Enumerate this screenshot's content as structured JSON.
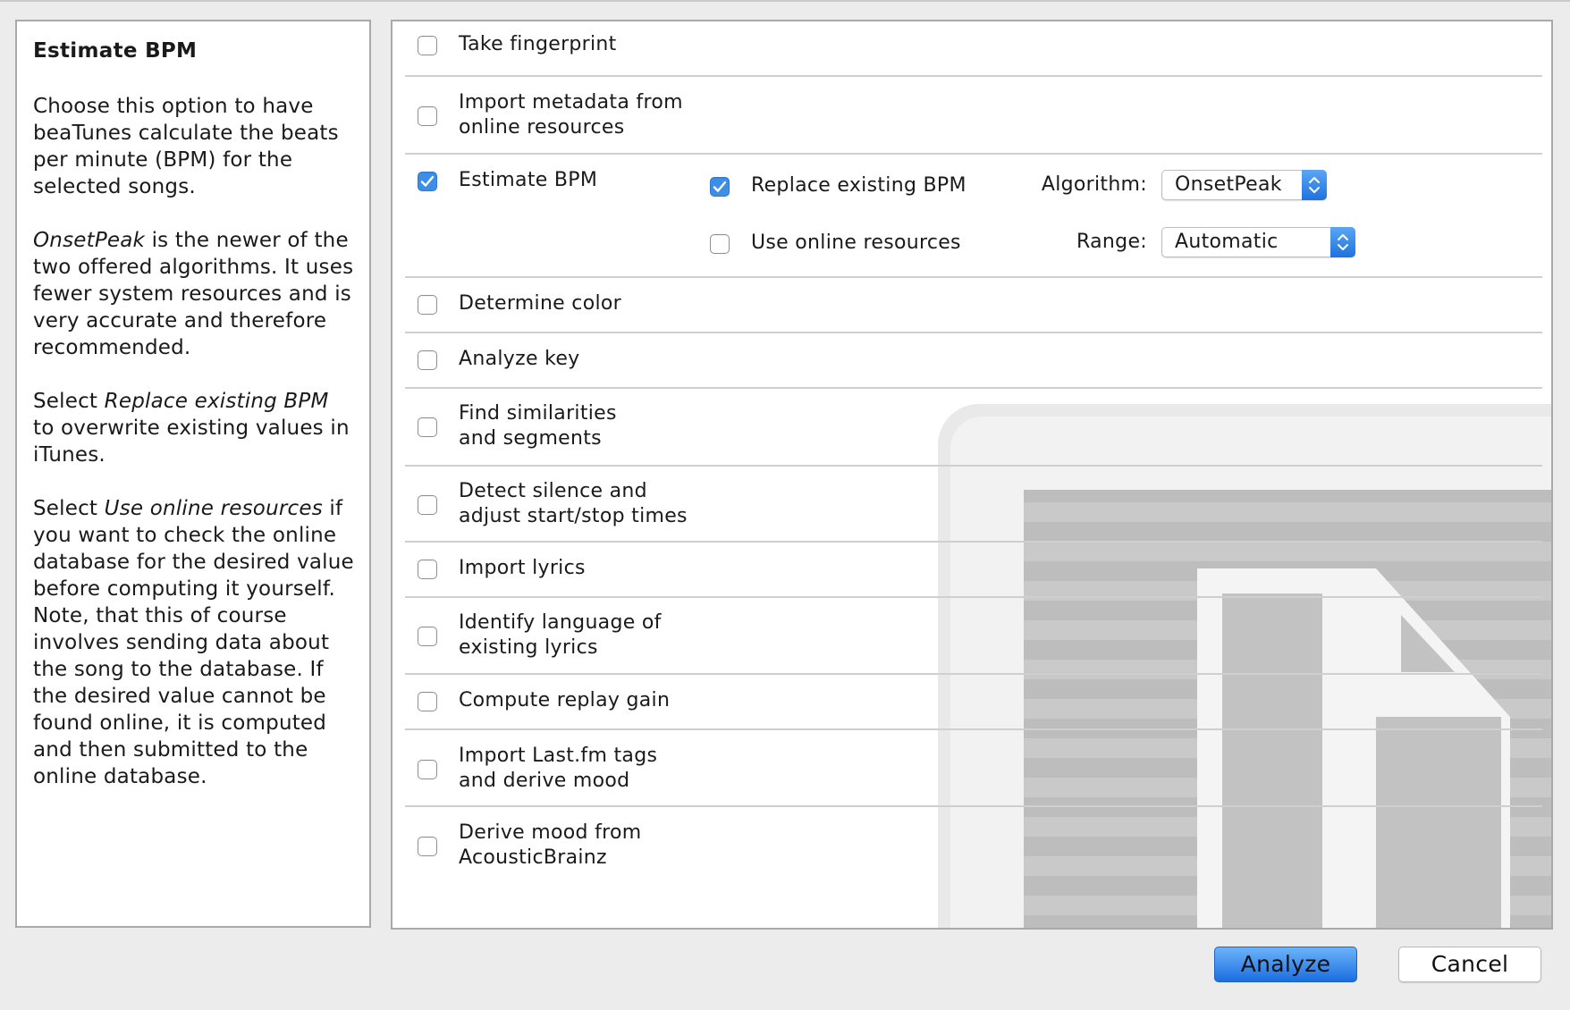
{
  "help": {
    "title": "Estimate BPM",
    "p1": "Choose this option to have beaTunes calculate the beats per minute (BPM) for the selected songs.",
    "p2_em": "OnsetPeak",
    "p2_rest": " is the newer of the two offered algorithms. It uses fewer system resources and is very accurate and therefore recommended.",
    "p3_pre": "Select ",
    "p3_em": "Replace existing BPM",
    "p3_rest": " to overwrite existing values in iTunes.",
    "p4_pre": "Select ",
    "p4_em": "Use online resources",
    "p4_rest": " if you want to check the online database for the desired value before computing it yourself. Note, that this of course involves sending data about the song to the database. If the desired value cannot be found online, it is computed and then submitted to the online database."
  },
  "options": [
    {
      "line1": "Take fingerprint",
      "line2": "",
      "checked": false
    },
    {
      "line1": "Import metadata from",
      "line2": "online resources",
      "checked": false
    },
    {
      "line1": "Estimate BPM",
      "line2": "",
      "checked": true
    },
    {
      "line1": "Determine color",
      "line2": "",
      "checked": false
    },
    {
      "line1": "Analyze key",
      "line2": "",
      "checked": false
    },
    {
      "line1": "Find similarities",
      "line2": "and segments",
      "checked": false
    },
    {
      "line1": "Detect silence and",
      "line2": "adjust start/stop times",
      "checked": false
    },
    {
      "line1": "Import lyrics",
      "line2": "",
      "checked": false
    },
    {
      "line1": "Identify language of",
      "line2": "existing lyrics",
      "checked": false
    },
    {
      "line1": "Compute replay gain",
      "line2": "",
      "checked": false
    },
    {
      "line1": "Import Last.fm tags",
      "line2": "and derive mood",
      "checked": false
    },
    {
      "line1": "Derive mood from",
      "line2": "AcousticBrainz",
      "checked": false
    }
  ],
  "bpm": {
    "replace_label": "Replace existing BPM",
    "replace_checked": true,
    "online_label": "Use online resources",
    "online_checked": false,
    "algorithm_label": "Algorithm:",
    "algorithm_value": "OnsetPeak",
    "range_label": "Range:",
    "range_value": "Automatic"
  },
  "buttons": {
    "analyze": "Analyze",
    "cancel": "Cancel"
  },
  "colors": {
    "accent": "#3d8fe6",
    "border": "#a9a9a9",
    "background": "#ececec"
  }
}
